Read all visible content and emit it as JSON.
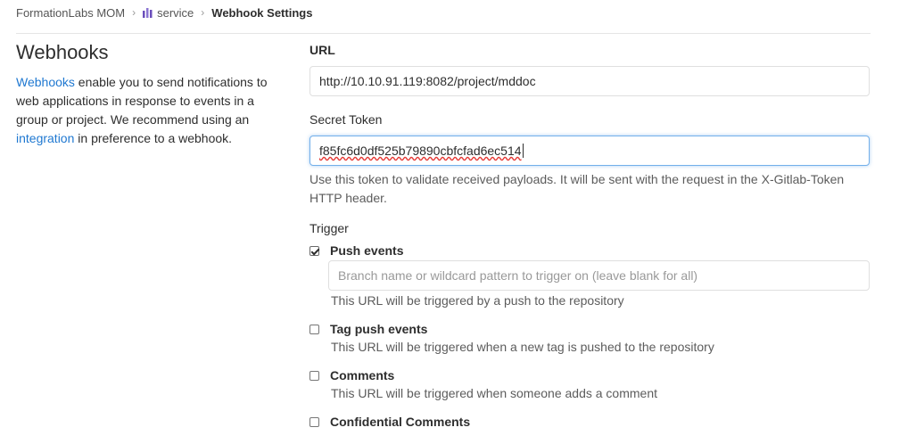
{
  "breadcrumb": {
    "group": "FormationLabs MOM",
    "project": "service",
    "current": "Webhook Settings",
    "project_icon": "project-icon"
  },
  "sidebar": {
    "title": "Webhooks",
    "desc_link1": "Webhooks",
    "desc_text1": " enable you to send notifications to web applications in response to events in a group or project. We recommend using an ",
    "desc_link2": "integration",
    "desc_text2": " in preference to a webhook."
  },
  "form": {
    "url_label": "URL",
    "url_value": "http://10.10.91.119:8082/project/mddoc",
    "token_label": "Secret Token",
    "token_value": "f85fc6d0df525b79890cbfcfad6ec514",
    "token_help": "Use this token to validate received payloads. It will be sent with the request in the X-Gitlab-Token HTTP header.",
    "trigger_label": "Trigger",
    "triggers": [
      {
        "label": "Push events",
        "checked": true,
        "help": "This URL will be triggered by a push to the repository",
        "branch_placeholder": "Branch name or wildcard pattern to trigger on (leave blank for all)"
      },
      {
        "label": "Tag push events",
        "checked": false,
        "help": "This URL will be triggered when a new tag is pushed to the repository"
      },
      {
        "label": "Comments",
        "checked": false,
        "help": "This URL will be triggered when someone adds a comment"
      },
      {
        "label": "Confidential Comments",
        "checked": false
      }
    ]
  },
  "colors": {
    "link": "#1f78d1",
    "focus_border": "#73afea"
  }
}
